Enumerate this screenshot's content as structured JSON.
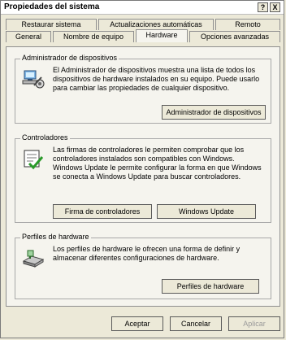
{
  "window": {
    "title": "Propiedades del sistema",
    "help_glyph": "?",
    "close_glyph": "X"
  },
  "tabs": {
    "row1": [
      "Restaurar sistema",
      "Actualizaciones automáticas",
      "Remoto"
    ],
    "row2": [
      "General",
      "Nombre de equipo",
      "Hardware",
      "Opciones avanzadas"
    ],
    "active": "Hardware"
  },
  "groups": {
    "device_manager": {
      "title": "Administrador de dispositivos",
      "text": "El Administrador de dispositivos muestra una lista de todos los dispositivos de hardware instalados en su equipo. Puede usarlo para cambiar las propiedades de cualquier dispositivo.",
      "button": "Administrador de dispositivos",
      "icon": "device-manager-icon"
    },
    "drivers": {
      "title": "Controladores",
      "text": "Las firmas de controladores le permiten comprobar que los controladores instalados son compatibles con Windows. Windows Update le permite configurar la forma en que Windows se conecta a Windows Update para buscar controladores.",
      "button_signing": "Firma de controladores",
      "button_update": "Windows Update",
      "icon": "driver-certificate-icon"
    },
    "hardware_profiles": {
      "title": "Perfiles de hardware",
      "text": "Los perfiles de hardware le ofrecen una forma de definir y almacenar diferentes configuraciones de hardware.",
      "button": "Perfiles de hardware",
      "icon": "hardware-profile-icon"
    }
  },
  "footer": {
    "ok": "Aceptar",
    "cancel": "Cancelar",
    "apply": "Aplicar"
  },
  "colors": {
    "window_bg": "#ece9d8",
    "panel_bg": "#f5f4ee",
    "border": "#8f8f8f"
  }
}
